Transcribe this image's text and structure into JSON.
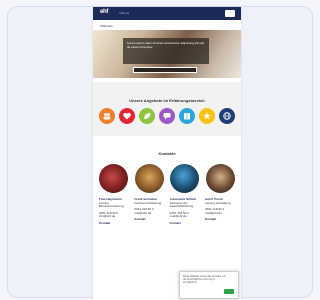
{
  "app": {
    "logo_text": "ehf",
    "logo_sub": "Stiftung",
    "breadcrumb": "Startseite",
    "hero_text": "Lorem ipsum dolor sit amet consectetur adipiscing elit sed do eiusmod tempor",
    "section1_title": "Unsere Angebote im Erfahrungsbereich",
    "section2_title": "Kontakte",
    "cookie_text": "Diese Website verwendet Cookies, um die bestmögliche Nutzung zu ermöglichen."
  },
  "colors": {
    "topbar": "#1c2a57",
    "icon_colors": [
      "#f07e2a",
      "#e32633",
      "#8cc63f",
      "#9a57c6",
      "#2aa6e0",
      "#f9c21a",
      "#1c3f7a"
    ]
  },
  "icons": [
    {
      "name": "people-icon"
    },
    {
      "name": "heart-icon"
    },
    {
      "name": "leaf-icon"
    },
    {
      "name": "chat-icon"
    },
    {
      "name": "book-icon"
    },
    {
      "name": "star-icon"
    },
    {
      "name": "globe-icon"
    }
  ],
  "contacts": [
    {
      "name": "Frau Hagemann",
      "role": "Leitung Berufsorientierung",
      "phone": "0251 418 50 0",
      "email": "info@ehf.de",
      "link": "Kontakt"
    },
    {
      "name": "Frank Schrieber",
      "role": "Fachbereichsleitung",
      "phone": "0251 418 50 2",
      "email": "mail@ehf.de",
      "link": "Kontakt"
    },
    {
      "name": "Annemarie Schmit",
      "role": "Assistenz der Geschäftsführung",
      "phone": "0251 418 50 3",
      "email": "mail@ehf.de",
      "link": "Kontakt"
    },
    {
      "name": "Gerrit Pirsch",
      "role": "Leitung Verwaltung",
      "phone": "0251 418 50 4",
      "email": "mail@ehf.de",
      "link": "Kontakt"
    }
  ]
}
